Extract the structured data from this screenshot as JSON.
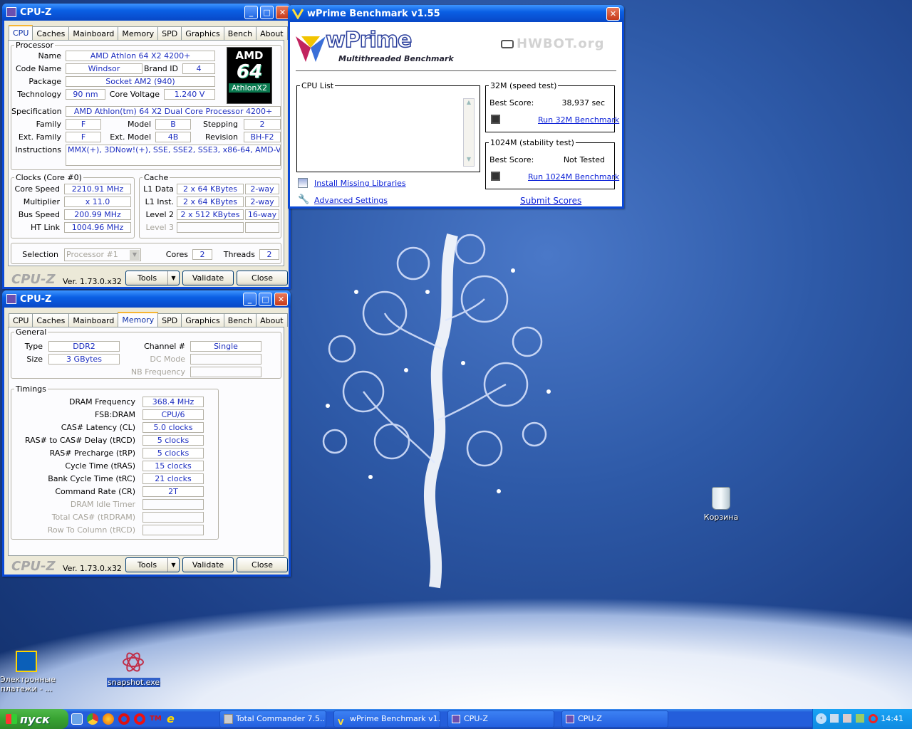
{
  "desktop": {
    "recycle_bin": "Корзина",
    "icons": [
      {
        "label": "Электронные платежи - ..."
      },
      {
        "label": "snapshot.exe"
      }
    ]
  },
  "cpuz_cpu": {
    "title": "CPU-Z",
    "tabs": [
      "CPU",
      "Caches",
      "Mainboard",
      "Memory",
      "SPD",
      "Graphics",
      "Bench",
      "About"
    ],
    "active_tab": "CPU",
    "processor_legend": "Processor",
    "name_label": "Name",
    "name": "AMD Athlon 64 X2 4200+",
    "codename_label": "Code Name",
    "codename": "Windsor",
    "brandid_label": "Brand ID",
    "brandid": "4",
    "package_label": "Package",
    "package": "Socket AM2 (940)",
    "technology_label": "Technology",
    "technology": "90 nm",
    "voltage_label": "Core Voltage",
    "voltage": "1.240 V",
    "spec_label": "Specification",
    "spec": "AMD Athlon(tm) 64 X2 Dual Core Processor 4200+",
    "family_label": "Family",
    "family": "F",
    "model_label": "Model",
    "model": "B",
    "stepping_label": "Stepping",
    "stepping": "2",
    "extfamily_label": "Ext. Family",
    "extfamily": "F",
    "extmodel_label": "Ext. Model",
    "extmodel": "4B",
    "revision_label": "Revision",
    "revision": "BH-F2",
    "instructions_label": "Instructions",
    "instructions": "MMX(+), 3DNow!(+), SSE, SSE2, SSE3, x86-64, AMD-V",
    "logo": {
      "line1": "AMD",
      "line2": "64",
      "line3": "AthlonX2"
    },
    "clocks_legend": "Clocks (Core #0)",
    "corespeed_label": "Core Speed",
    "corespeed": "2210.91 MHz",
    "multiplier_label": "Multiplier",
    "multiplier": "x 11.0",
    "busspeed_label": "Bus Speed",
    "busspeed": "200.99 MHz",
    "htlink_label": "HT Link",
    "htlink": "1004.96 MHz",
    "cache_legend": "Cache",
    "l1d_label": "L1 Data",
    "l1d": "2 x 64 KBytes",
    "l1d_way": "2-way",
    "l1i_label": "L1 Inst.",
    "l1i": "2 x 64 KBytes",
    "l1i_way": "2-way",
    "l2_label": "Level 2",
    "l2": "2 x 512 KBytes",
    "l2_way": "16-way",
    "l3_label": "Level 3",
    "selection_label": "Selection",
    "selection": "Processor #1",
    "cores_label": "Cores",
    "cores": "2",
    "threads_label": "Threads",
    "threads": "2",
    "footer_logo": "CPU-Z",
    "version": "Ver. 1.73.0.x32",
    "tools": "Tools",
    "validate": "Validate",
    "close": "Close"
  },
  "cpuz_mem": {
    "title": "CPU-Z",
    "tabs": [
      "CPU",
      "Caches",
      "Mainboard",
      "Memory",
      "SPD",
      "Graphics",
      "Bench",
      "About"
    ],
    "active_tab": "Memory",
    "general_legend": "General",
    "type_label": "Type",
    "type": "DDR2",
    "size_label": "Size",
    "size": "3 GBytes",
    "channel_label": "Channel #",
    "channel": "Single",
    "dcmode_label": "DC Mode",
    "nbfreq_label": "NB Frequency",
    "timings_legend": "Timings",
    "timings": [
      {
        "label": "DRAM Frequency",
        "value": "368.4 MHz"
      },
      {
        "label": "FSB:DRAM",
        "value": "CPU/6"
      },
      {
        "label": "CAS# Latency (CL)",
        "value": "5.0 clocks"
      },
      {
        "label": "RAS# to CAS# Delay (tRCD)",
        "value": "5 clocks"
      },
      {
        "label": "RAS# Precharge (tRP)",
        "value": "5 clocks"
      },
      {
        "label": "Cycle Time (tRAS)",
        "value": "15 clocks"
      },
      {
        "label": "Bank Cycle Time (tRC)",
        "value": "21 clocks"
      },
      {
        "label": "Command Rate (CR)",
        "value": "2T"
      },
      {
        "label": "DRAM Idle Timer",
        "value": ""
      },
      {
        "label": "Total CAS# (tRDRAM)",
        "value": ""
      },
      {
        "label": "Row To Column (tRCD)",
        "value": ""
      }
    ],
    "footer_logo": "CPU-Z",
    "version": "Ver. 1.73.0.x32",
    "tools": "Tools",
    "validate": "Validate",
    "close": "Close"
  },
  "wprime": {
    "title": "wPrime Benchmark v1.55",
    "logo": "wPrime",
    "logo_sub": "Multithreaded Benchmark",
    "hwbot": "HWBOT.org",
    "cpu_list_legend": "CPU List",
    "test32_legend": "32M (speed test)",
    "best32_label": "Best Score:",
    "best32": "38,937 sec",
    "run32": "Run 32M Benchmark",
    "test1024_legend": "1024M (stability test)",
    "best1024_label": "Best Score:",
    "best1024": "Not Tested",
    "run1024": "Run 1024M Benchmark",
    "install_libs": "Install Missing Libraries",
    "advanced": "Advanced Settings",
    "submit": "Submit Scores"
  },
  "taskbar": {
    "start": "пуск",
    "tasks": [
      "Total Commander 7.5...",
      "wPrime Benchmark v1...",
      "CPU-Z",
      "CPU-Z"
    ],
    "clock": "14:41"
  },
  "colors": {
    "titlebar": "#0a5fe4",
    "value_text": "#1d2ec0",
    "start_green": "#38a332"
  }
}
